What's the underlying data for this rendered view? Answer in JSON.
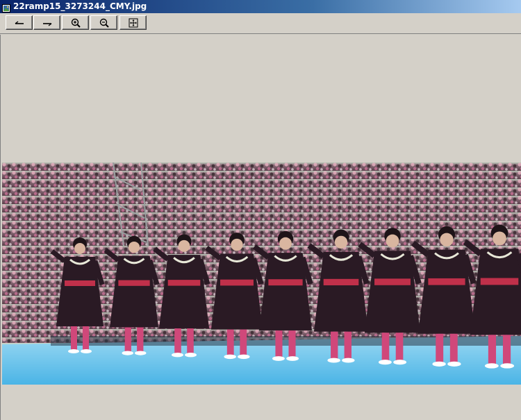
{
  "window": {
    "title": "22ramp15_3273244_CMY.jpg",
    "icon": "image-file-icon"
  },
  "toolbar": {
    "buttons": [
      {
        "name": "previous-button",
        "icon": "arrow-left-icon"
      },
      {
        "name": "next-button",
        "icon": "arrow-right-icon"
      },
      {
        "name": "zoom-in-button",
        "icon": "zoom-in-icon"
      },
      {
        "name": "zoom-out-button",
        "icon": "zoom-out-icon"
      },
      {
        "name": "fit-to-window-button",
        "icon": "fit-window-icon"
      }
    ]
  },
  "colors": {
    "title_bar_start": "#0a246a",
    "title_bar_end": "#a6caf0",
    "window_background": "#d4d0c8",
    "stage_blue": "#6fc6ec",
    "costume_black": "#2a1a24",
    "sash_red": "#c0304a",
    "leggings_pink": "#d0487a"
  }
}
